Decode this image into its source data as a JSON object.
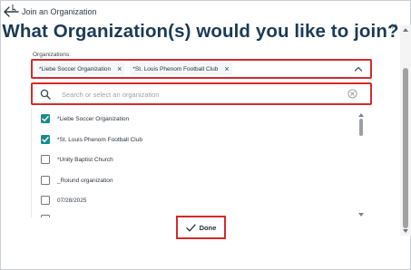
{
  "header": {
    "back_label": "Join an Organization",
    "headline": "What Organization(s) would you like to join?"
  },
  "form": {
    "organizations_label": "Organizations:",
    "selected_chips": [
      {
        "label": "*Liebe Soccer Organization"
      },
      {
        "label": "*St. Louis Phenom Football Club"
      }
    ],
    "search": {
      "value": "",
      "placeholder": "Search or select an organization"
    },
    "options": [
      {
        "label": "*Liebe Soccer Organization",
        "checked": true
      },
      {
        "label": "*St. Louis Phenom Football Club",
        "checked": true
      },
      {
        "label": "*Unity Baptist Church",
        "checked": false
      },
      {
        "label": "_Roiund organization",
        "checked": false
      },
      {
        "label": "07/28/2025",
        "checked": false
      }
    ],
    "done_label": "Done"
  },
  "colors": {
    "accent_red": "#d42b2b",
    "checkbox_teal": "#1a8a8a",
    "headline_navy": "#1b3a57"
  },
  "icons": [
    "back-arrow-icon",
    "close-icon",
    "chip-remove-icon",
    "chevron-up-icon",
    "search-icon",
    "clear-circle-icon",
    "checkmark-icon"
  ]
}
